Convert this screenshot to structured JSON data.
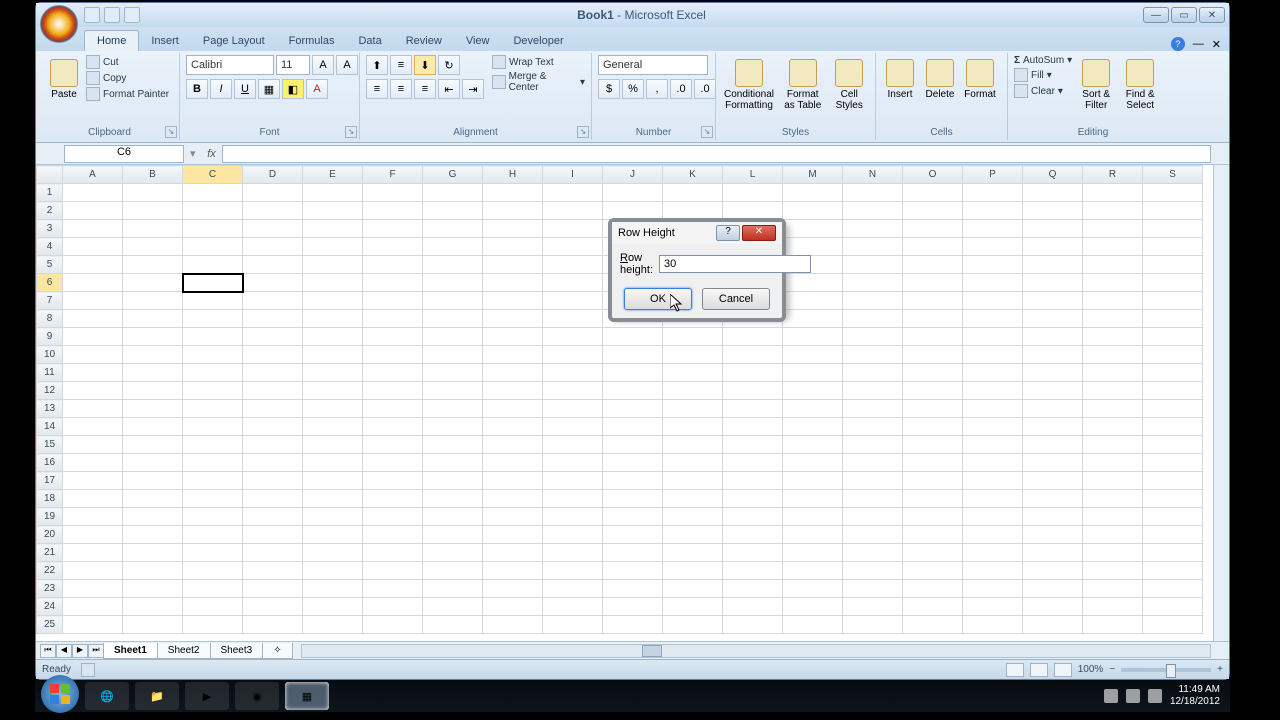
{
  "app": {
    "title_doc": "Book1",
    "title_app": "Microsoft Excel"
  },
  "tabs": [
    "Home",
    "Insert",
    "Page Layout",
    "Formulas",
    "Data",
    "Review",
    "View",
    "Developer"
  ],
  "active_tab": "Home",
  "clipboard": {
    "paste": "Paste",
    "cut": "Cut",
    "copy": "Copy",
    "format_painter": "Format Painter",
    "label": "Clipboard"
  },
  "font": {
    "name": "Calibri",
    "size": "11",
    "label": "Font"
  },
  "alignment": {
    "wrap": "Wrap Text",
    "merge": "Merge & Center",
    "label": "Alignment"
  },
  "number": {
    "format": "General",
    "label": "Number"
  },
  "styles": {
    "conditional": "Conditional\nFormatting",
    "format_table": "Format\nas Table",
    "cell_styles": "Cell\nStyles",
    "label": "Styles"
  },
  "cells": {
    "insert": "Insert",
    "delete": "Delete",
    "format": "Format",
    "label": "Cells"
  },
  "editing": {
    "autosum": "AutoSum",
    "fill": "Fill",
    "clear": "Clear",
    "sort": "Sort &\nFilter",
    "find": "Find &\nSelect",
    "label": "Editing"
  },
  "namebox": "C6",
  "columns": [
    "A",
    "B",
    "C",
    "D",
    "E",
    "F",
    "G",
    "H",
    "I",
    "J",
    "K",
    "L",
    "M",
    "N",
    "O",
    "P",
    "Q",
    "R",
    "S"
  ],
  "rows": [
    "1",
    "2",
    "3",
    "4",
    "5",
    "6",
    "7",
    "8",
    "9",
    "10",
    "11",
    "12",
    "13",
    "14",
    "15",
    "16",
    "17",
    "18",
    "19",
    "20",
    "21",
    "22",
    "23",
    "24",
    "25"
  ],
  "selected_cell": "C6",
  "selected_row": "6",
  "selected_col": "C",
  "sheets": [
    "Sheet1",
    "Sheet2",
    "Sheet3"
  ],
  "active_sheet": "Sheet1",
  "status": "Ready",
  "zoom": "100%",
  "dialog": {
    "title": "Row Height",
    "label_prefix": "R",
    "label_rest": "ow height:",
    "value": "30",
    "ok": "OK",
    "cancel": "Cancel"
  },
  "tray": {
    "time": "11:49 AM",
    "date": "12/18/2012"
  }
}
